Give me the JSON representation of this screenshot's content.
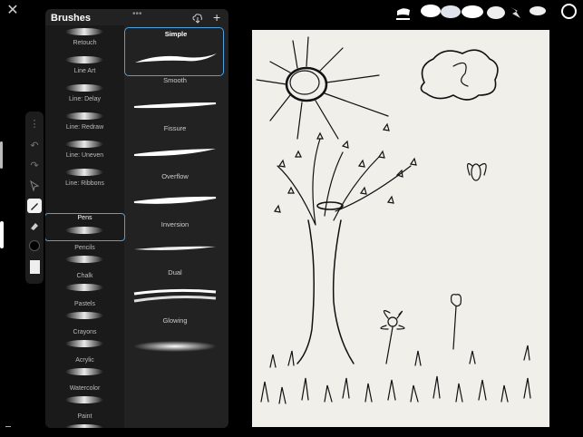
{
  "panel": {
    "title": "Brushes",
    "categories": [
      {
        "label": "Retouch"
      },
      {
        "label": "Line Art"
      },
      {
        "label": "Line: Delay"
      },
      {
        "label": "Line: Redraw"
      },
      {
        "label": "Line: Uneven"
      },
      {
        "label": "Line: Ribbons"
      },
      {
        "label": "Pens",
        "selected": true
      },
      {
        "label": "Pencils"
      },
      {
        "label": "Chalk"
      },
      {
        "label": "Pastels"
      },
      {
        "label": "Crayons"
      },
      {
        "label": "Acrylic"
      },
      {
        "label": "Watercolor"
      },
      {
        "label": "Paint"
      }
    ],
    "brushes": [
      {
        "label": "Simple",
        "selected": true
      },
      {
        "label": "Smooth"
      },
      {
        "label": "Fissure"
      },
      {
        "label": "Overflow"
      },
      {
        "label": "Inversion"
      },
      {
        "label": "Dual"
      },
      {
        "label": "Glowing"
      }
    ]
  },
  "icons": {
    "close": "close-icon",
    "import": "cloud-download-icon",
    "add": "plus-icon",
    "tools": [
      "more-icon",
      "undo-icon",
      "redo-icon",
      "select-arrow-icon",
      "brush-icon",
      "eraser-icon",
      "color-swatch-icon",
      "layer-thumbnail-icon"
    ]
  },
  "colors": {
    "accent": "#4aa3df",
    "panel_bg": "#222222",
    "canvas_bg": "#f0efea",
    "current_color": "#000000"
  },
  "glyphs": {
    "close": "✕",
    "add": "+",
    "grip": "•••",
    "more": "⋮",
    "undo": "↶",
    "redo": "↷"
  }
}
